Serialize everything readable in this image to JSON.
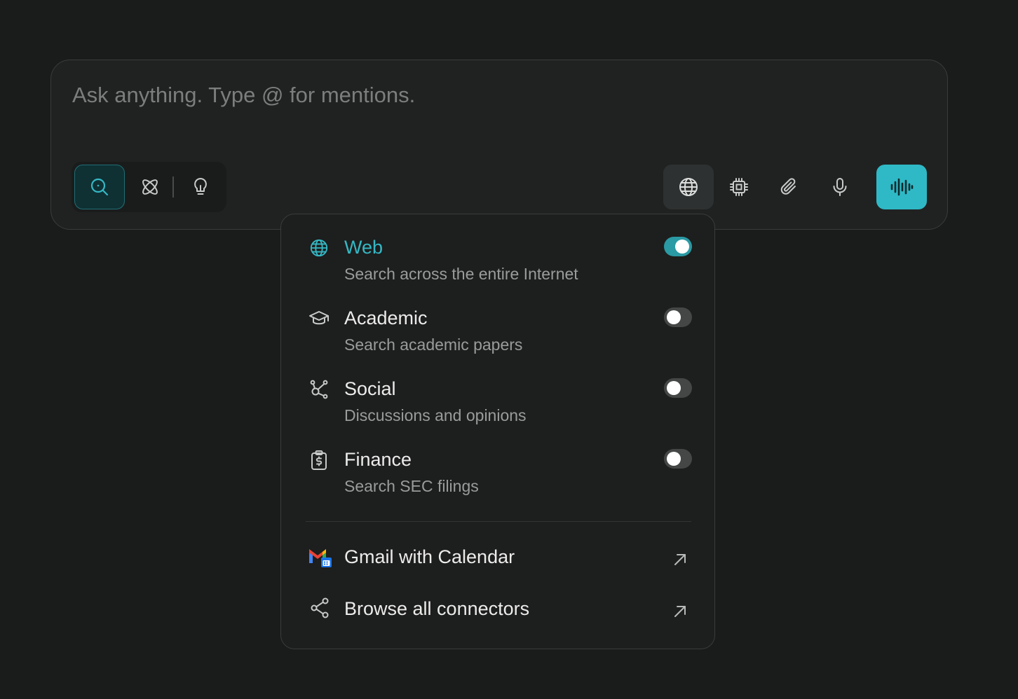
{
  "composer": {
    "placeholder": "Ask anything. Type @ for mentions.",
    "value": ""
  },
  "modes": [
    {
      "name": "search",
      "icon": "search-icon",
      "active": true
    },
    {
      "name": "research",
      "icon": "atom-icon",
      "active": false
    },
    {
      "name": "labs",
      "icon": "lightbulb-icon",
      "active": false
    }
  ],
  "tools": [
    {
      "icon": "globe-icon",
      "active": true
    },
    {
      "icon": "cpu-chip-icon",
      "active": false
    },
    {
      "icon": "paperclip-icon",
      "active": false
    },
    {
      "icon": "microphone-icon",
      "active": false
    },
    {
      "icon": "voice-waveform-icon",
      "active": false
    }
  ],
  "sources": {
    "items": [
      {
        "title": "Web",
        "description": "Search across the entire Internet",
        "icon": "globe-icon",
        "enabled": true
      },
      {
        "title": "Academic",
        "description": "Search academic papers",
        "icon": "graduation-cap-icon",
        "enabled": false
      },
      {
        "title": "Social",
        "description": "Discussions and opinions",
        "icon": "social-network-icon",
        "enabled": false
      },
      {
        "title": "Finance",
        "description": "Search SEC filings",
        "icon": "finance-clipboard-icon",
        "enabled": false
      }
    ]
  },
  "connectors": {
    "items": [
      {
        "label": "Gmail with Calendar",
        "icon": "gmail-calendar-icon"
      },
      {
        "label": "Browse all connectors",
        "icon": "share-nodes-icon"
      }
    ]
  },
  "colors": {
    "accent": "#2fb9c6",
    "background": "#1a1b1b",
    "panel": "#202222",
    "dropdown": "#1d1e1e"
  }
}
